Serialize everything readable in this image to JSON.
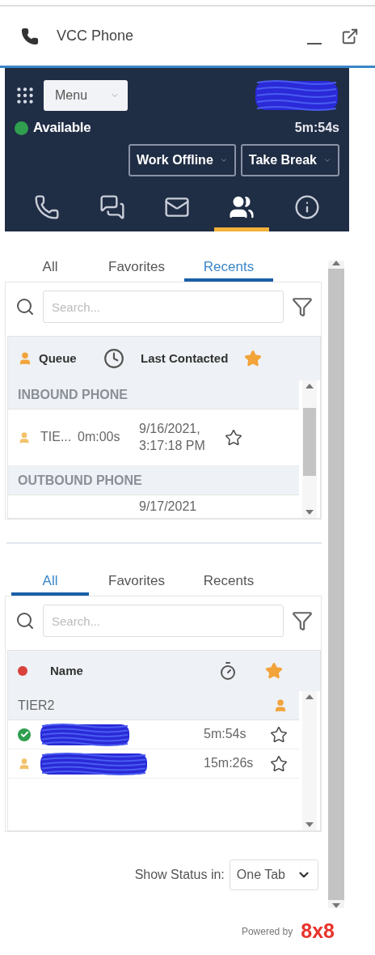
{
  "window": {
    "title": "VCC Phone"
  },
  "agent_bar": {
    "menu": "Menu",
    "status": {
      "label": "Available",
      "kind": "available"
    },
    "timer": "5m:54s",
    "buttons": [
      "Work Offline",
      "Take Break"
    ]
  },
  "nav": [
    {
      "kind": "phone",
      "selected": false
    },
    {
      "kind": "chat",
      "selected": false
    },
    {
      "kind": "mail",
      "selected": false
    },
    {
      "kind": "people",
      "selected": true
    },
    {
      "kind": "info",
      "selected": false
    }
  ],
  "queues_panel": {
    "tabs": [
      {
        "label": "All",
        "selected": false
      },
      {
        "label": "Favorites",
        "selected": false
      },
      {
        "label": "Recents",
        "selected": true
      }
    ],
    "search": {
      "placeholder": "Search..."
    },
    "columns": [
      "Queue",
      "Last Contacted"
    ],
    "groups": [
      {
        "title": "INBOUND PHONE",
        "rows": [
          {
            "queue": "TIE...",
            "time": "0m:00s",
            "last_contacted": "9/16/2021, 3:17:18 PM",
            "favorite": false
          }
        ]
      },
      {
        "title": "OUTBOUND PHONE",
        "rows": [
          {
            "last_contacted": "9/17/2021"
          }
        ]
      }
    ]
  },
  "agents_panel": {
    "tabs": [
      {
        "label": "All",
        "selected": true
      },
      {
        "label": "Favorites",
        "selected": false
      },
      {
        "label": "Recents",
        "selected": false
      }
    ],
    "search": {
      "placeholder": "Search..."
    },
    "columns": [
      "Name"
    ],
    "groups": [
      {
        "title": "TIER2",
        "rows": [
          {
            "kind": "available",
            "time": "5m:54s",
            "favorite": false
          },
          {
            "kind": "away",
            "time": "15m:26s",
            "favorite": false
          }
        ]
      }
    ]
  },
  "show_status": {
    "label": "Show Status in:",
    "value": "One Tab"
  },
  "footer": {
    "label": "Powered by",
    "brand": "8x8"
  }
}
